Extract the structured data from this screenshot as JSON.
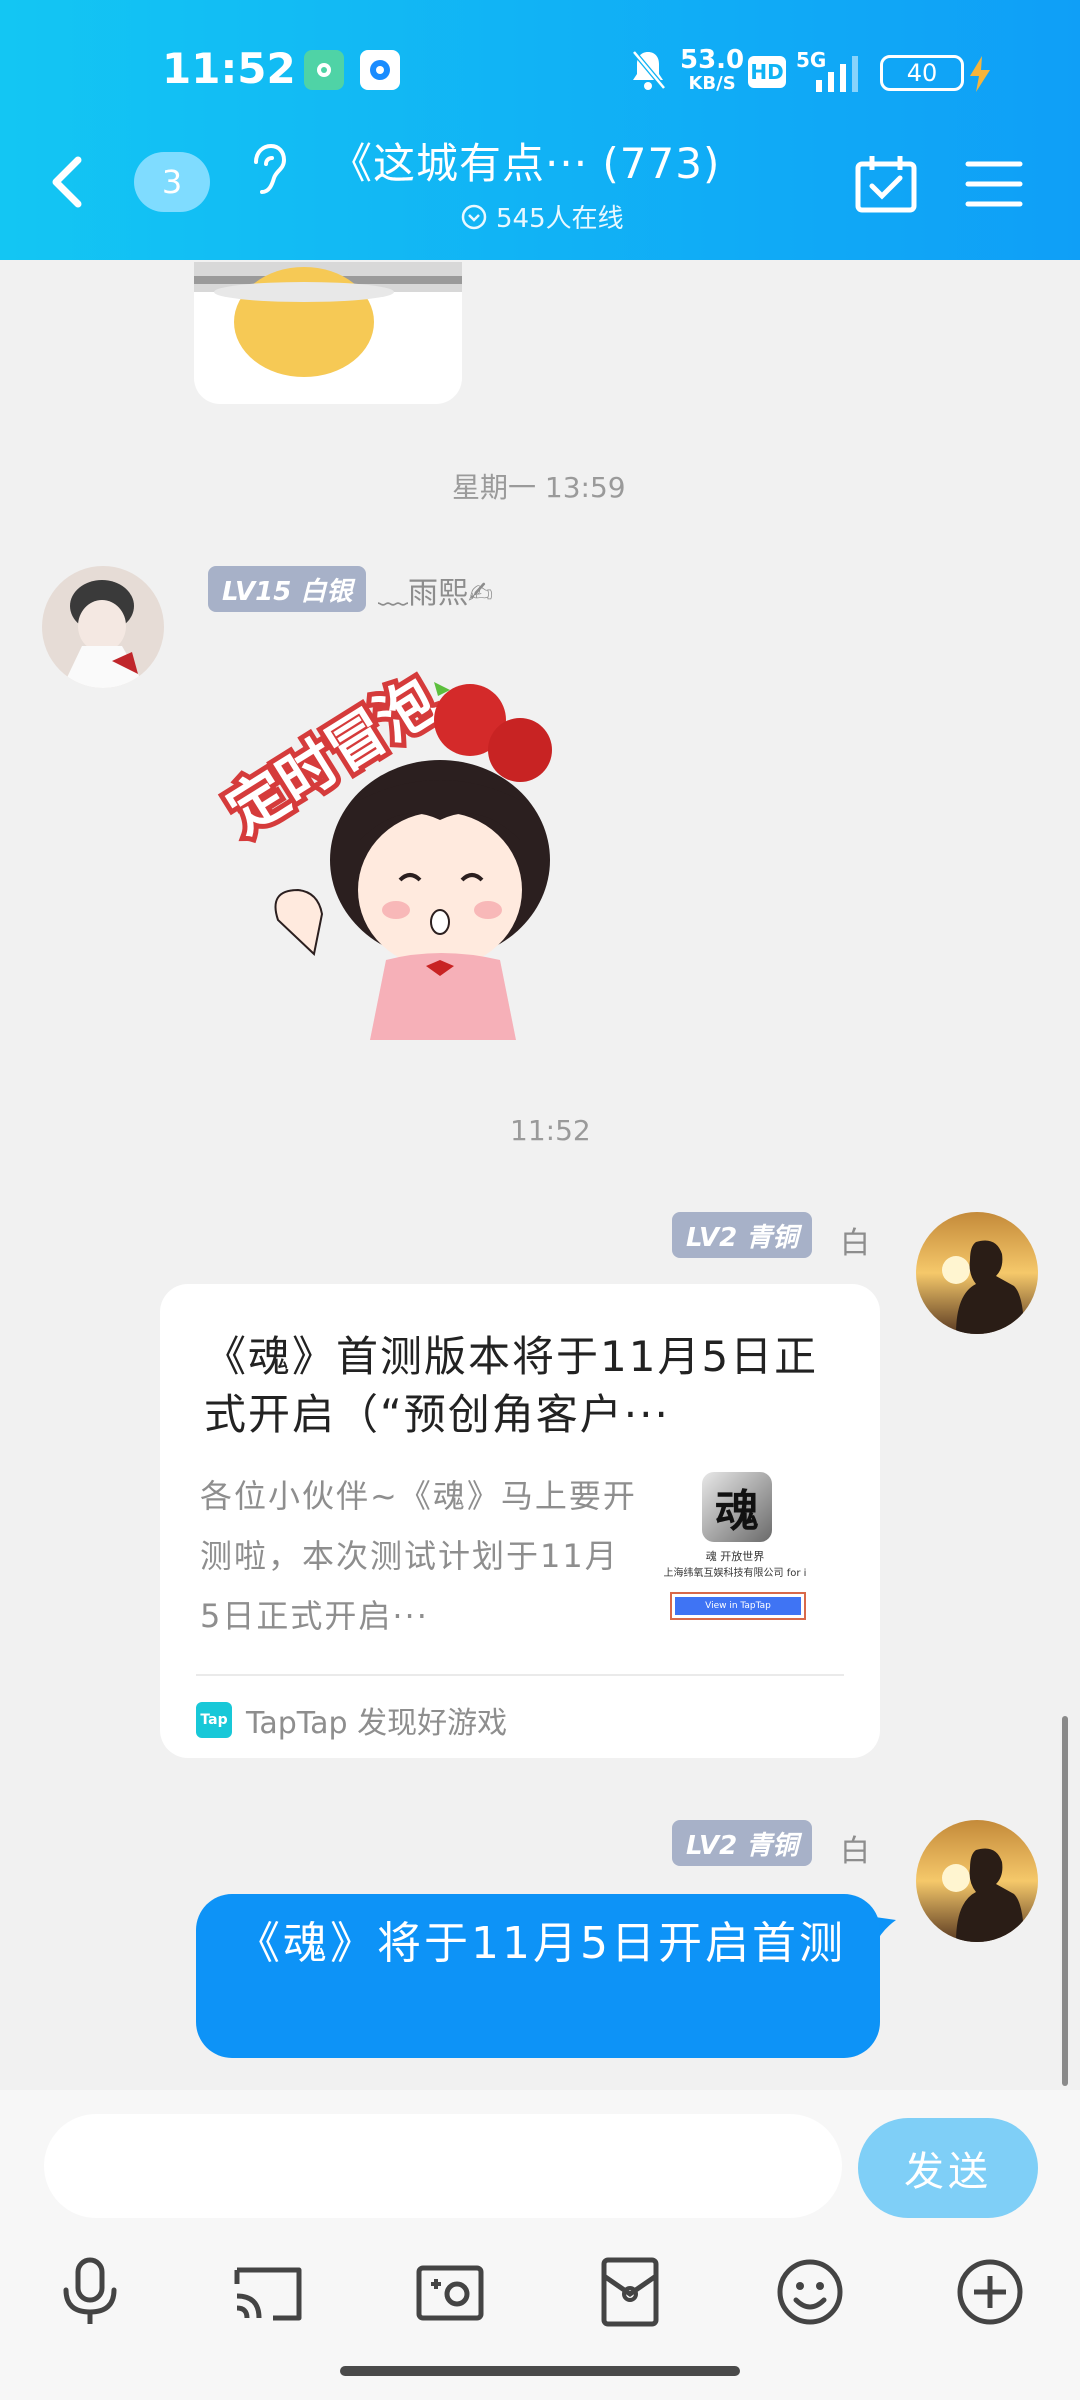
{
  "status_bar": {
    "time": "11:52",
    "net_speed_value": "53.0",
    "net_speed_unit": "KB/S",
    "hd_label": "HD",
    "network_label": "5G",
    "battery": "40"
  },
  "header": {
    "unread_count": "3",
    "title": "《这城有点··· (773)",
    "online_text": "545人在线"
  },
  "messages": {
    "timestamp_1": "星期一 13:59",
    "sender_1": {
      "level": "LV15 白银",
      "name": "﹏雨熙✍"
    },
    "sticker_text": "定时冒泡",
    "timestamp_2": "11:52",
    "sender_2": {
      "level": "LV2 青铜",
      "name": "白"
    },
    "share_card": {
      "title": "《魂》首测版本将于11月5日正式开启（“预创角客户···",
      "description": "各位小伙伴~《魂》马上要开测啦，本次测试计划于11月5日正式开启···",
      "thumb_char": "魂",
      "thumb_line1": "魂 开放世界",
      "thumb_line2": "上海纬氧互娱科技有限公司 for i",
      "thumb_button": "View in TapTap",
      "source_logo": "Tap",
      "source": "TapTap 发现好游戏"
    },
    "sender_3": {
      "level": "LV2 青铜",
      "name": "白"
    },
    "bubble_text": "《魂》将于11月5日开启首测"
  },
  "input_bar": {
    "input_value": "",
    "send_label": "发送"
  },
  "colors": {
    "header_start": "#13c6f3",
    "header_end": "#0f9ff7",
    "bubble": "#0d93f7",
    "level_badge": "#a7b1c8",
    "send_button": "#7fcff7"
  }
}
